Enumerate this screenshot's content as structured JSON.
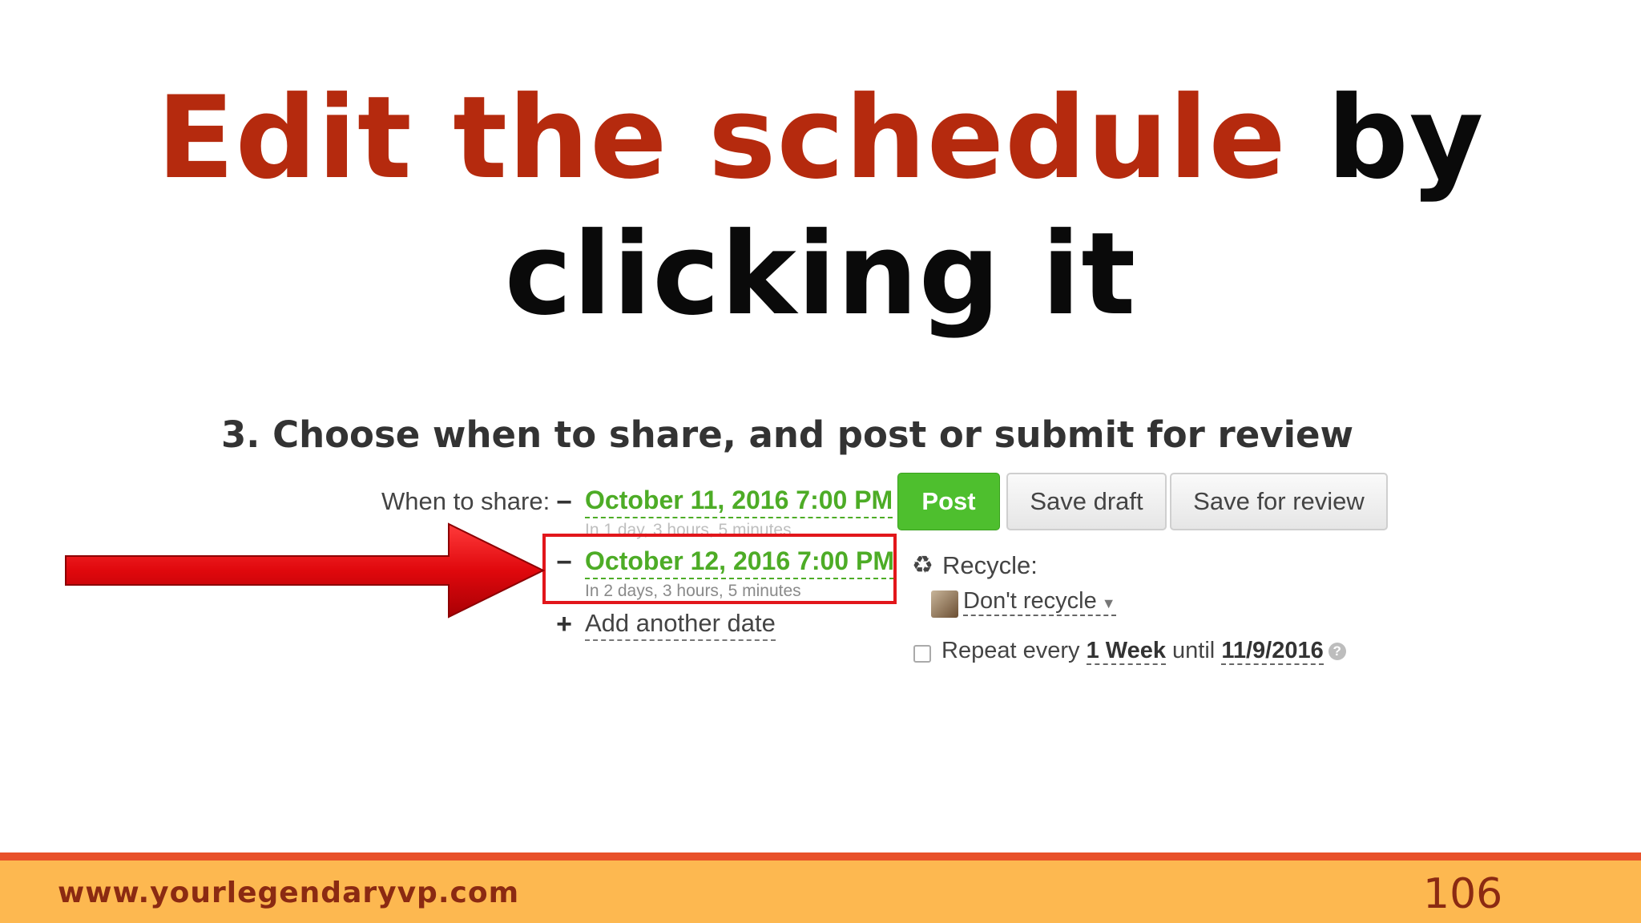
{
  "slide": {
    "title_accent": "Edit the schedule",
    "title_rest": "by clicking it"
  },
  "screenshot": {
    "heading": "3. Choose when to share, and post or submit for review",
    "when_to_share_label": "When to share:",
    "dates": [
      {
        "date": "October 11, 2016 7:00 PM",
        "relative": "In 1 day, 3 hours, 5 minutes"
      },
      {
        "date": "October 12, 2016 7:00 PM",
        "relative": "In 2 days, 3 hours, 5 minutes"
      }
    ],
    "add_date_label": "Add another date",
    "buttons": {
      "post": "Post",
      "save_draft": "Save draft",
      "save_review": "Save for review"
    },
    "recycle": {
      "label": "Recycle:",
      "value": "Don't recycle"
    },
    "repeat": {
      "prefix": "Repeat every",
      "interval": "1 Week",
      "until_label": "until",
      "until_date": "11/9/2016"
    },
    "icons": {
      "recycle": "recycle-icon",
      "minus": "minus-icon",
      "plus": "plus-icon",
      "help": "help-icon",
      "arrow": "arrow-icon"
    },
    "colors": {
      "date_green": "#4dac26",
      "post_green": "#4ebf2e",
      "highlight_red": "#e2161b"
    }
  },
  "footer": {
    "url": "www.yourlegendaryvp.com",
    "page_number": "106"
  }
}
